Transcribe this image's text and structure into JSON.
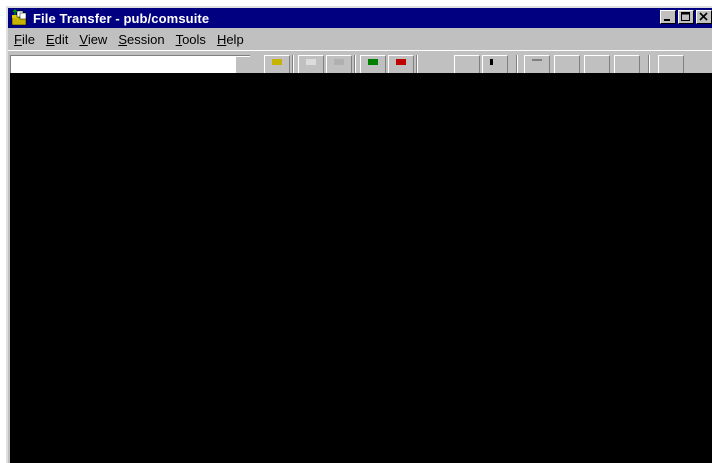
{
  "window": {
    "title": "File Transfer - pub/comsuite",
    "icon": "file-transfer-icon"
  },
  "title_buttons": [
    "minimize-icon",
    "maximize-icon",
    "close-icon"
  ],
  "menu": [
    {
      "accel": "F",
      "rest": "ile"
    },
    {
      "accel": "E",
      "rest": "dit"
    },
    {
      "accel": "V",
      "rest": "iew"
    },
    {
      "accel": "S",
      "rest": "ession"
    },
    {
      "accel": "T",
      "rest": "ools"
    },
    {
      "accel": "H",
      "rest": "elp"
    }
  ],
  "toolbar": {
    "address_value": "",
    "buttons": [
      "connect-icon",
      "new-icon",
      "copy-icon",
      "transfer-up-icon",
      "transfer-down-icon",
      "cut-icon",
      "paste-icon",
      "view-list-icon",
      "view-details-icon",
      "view-large-icon",
      "view-small-icon",
      "properties-icon"
    ]
  },
  "colors": {
    "titlebar": "#000080",
    "chrome": "#c0c0c0",
    "content": "#000000"
  }
}
